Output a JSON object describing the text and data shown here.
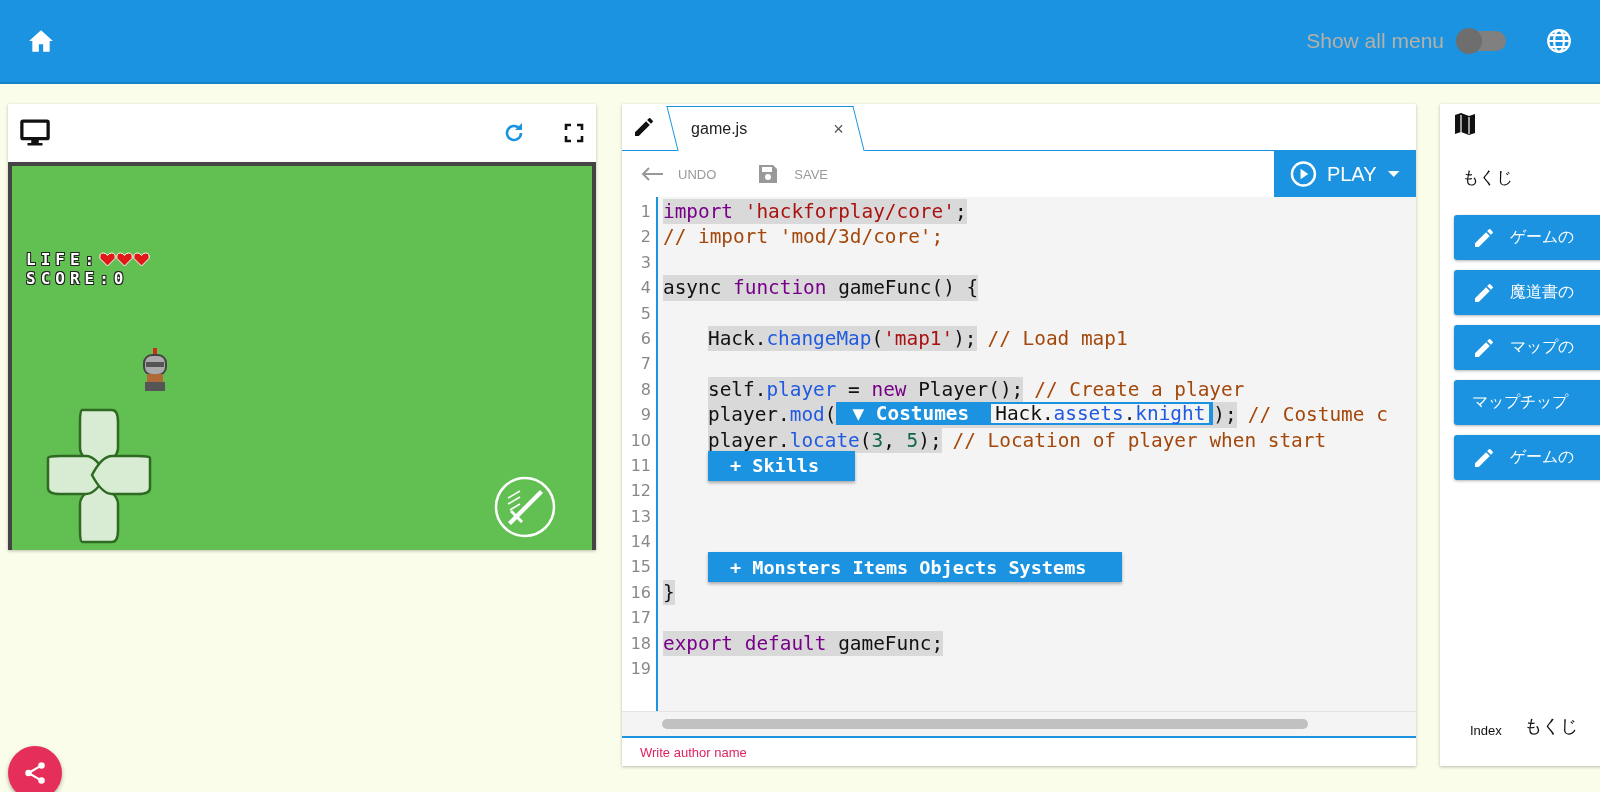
{
  "header": {
    "show_all_menu": {
      "label": "Show all menu",
      "on": false
    }
  },
  "preview": {
    "hud": {
      "life_label": "LIFE:",
      "hearts": [
        {
          "filled": true
        },
        {
          "filled": true
        },
        {
          "filled": true
        }
      ],
      "score": "SCORE:0"
    }
  },
  "editor": {
    "tabs": [
      {
        "label": "game.js",
        "selected": true,
        "close": "×"
      }
    ],
    "toolbar": {
      "undo": {
        "label": "UNDO",
        "disabled": true
      },
      "save": {
        "label": "SAVE",
        "disabled": true
      },
      "play": {
        "label": "PLAY"
      }
    },
    "lines": [
      {
        "number": "1",
        "kind": "code",
        "highlight": true,
        "tokens": [
          {
            "text": "import ",
            "kind": "keyword"
          },
          {
            "text": "'hackforplay/core'",
            "kind": "string"
          },
          {
            "text": ";",
            "kind": "plain"
          }
        ]
      },
      {
        "number": "2",
        "kind": "code",
        "tokens": [
          {
            "text": "// import 'mod/3d/core';",
            "kind": "comment"
          }
        ]
      },
      {
        "number": "3",
        "kind": "code"
      },
      {
        "number": "4",
        "kind": "code",
        "highlight": true,
        "tokens": [
          {
            "text": "async ",
            "kind": "plain"
          },
          {
            "text": "function",
            "kind": "keyword"
          },
          {
            "text": " gameFunc() {",
            "kind": "plain"
          }
        ]
      },
      {
        "number": "5",
        "kind": "code"
      },
      {
        "number": "6",
        "kind": "code",
        "highlight": true,
        "indent": true,
        "tokens": [
          {
            "text": "Hack.",
            "kind": "plain"
          },
          {
            "text": "changeMap",
            "kind": "property"
          },
          {
            "text": "(",
            "kind": "plain"
          },
          {
            "text": "'map1'",
            "kind": "string"
          },
          {
            "text": ");",
            "kind": "plain"
          },
          {
            "text": "// Load map1",
            "kind": "comment"
          }
        ]
      },
      {
        "number": "7",
        "kind": "code"
      },
      {
        "number": "8",
        "kind": "code",
        "highlight": true,
        "indent": true,
        "tokens": [
          {
            "text": "self.",
            "kind": "plain"
          },
          {
            "text": "player",
            "kind": "property"
          },
          {
            "text": " = ",
            "kind": "plain"
          },
          {
            "text": "new",
            "kind": "keyword"
          },
          {
            "text": " Player();",
            "kind": "plain"
          },
          {
            "text": "// Create a player",
            "kind": "comment"
          }
        ]
      },
      {
        "number": "9",
        "kind": "code",
        "highlight": true,
        "indent": true,
        "tokens": [
          {
            "text": "player.",
            "kind": "plain"
          },
          {
            "text": "mod",
            "kind": "property"
          },
          {
            "text": "(",
            "kind": "plain"
          },
          {
            "kind": "widget",
            "label": "▼ Costumes",
            "tokens": [
              {
                "text": "Hack.",
                "kind": "plain"
              },
              {
                "text": "assets",
                "kind": "property"
              },
              {
                "text": ".",
                "kind": "plain"
              },
              {
                "text": "knight",
                "kind": "property"
              }
            ]
          },
          {
            "text": ");",
            "kind": "plain"
          },
          {
            "text": "// Costume c",
            "kind": "comment"
          }
        ]
      },
      {
        "number": "10",
        "kind": "code",
        "highlight": true,
        "indent": true,
        "tokens": [
          {
            "text": "player.",
            "kind": "plain"
          },
          {
            "text": "locate",
            "kind": "property"
          },
          {
            "text": "(",
            "kind": "plain"
          },
          {
            "text": "3",
            "kind": "number"
          },
          {
            "text": ", ",
            "kind": "plain"
          },
          {
            "text": "5",
            "kind": "number"
          },
          {
            "text": ");",
            "kind": "plain"
          },
          {
            "text": "// Location of player when start",
            "kind": "comment"
          }
        ]
      },
      {
        "number": "11",
        "kind": "button",
        "label": "+ Skills"
      },
      {
        "number": "12",
        "kind": "code"
      },
      {
        "number": "13",
        "kind": "code"
      },
      {
        "number": "14",
        "kind": "code"
      },
      {
        "number": "15",
        "kind": "button",
        "label": "+ Monsters Items Objects Systems"
      },
      {
        "number": "16",
        "kind": "code",
        "highlight": true,
        "tokens": [
          {
            "text": "}",
            "kind": "plain"
          }
        ]
      },
      {
        "number": "17",
        "kind": "code"
      },
      {
        "number": "18",
        "kind": "code",
        "highlight": true,
        "tokens": [
          {
            "text": "export default",
            "kind": "keyword"
          },
          {
            "text": " gameFunc;",
            "kind": "plain"
          }
        ]
      },
      {
        "number": "19",
        "kind": "code"
      }
    ],
    "author_placeholder": "Write author name"
  },
  "index_panel": {
    "title": "もくじ",
    "items": [
      {
        "label": "ゲームの",
        "kind": "edit"
      },
      {
        "label": "魔道書の",
        "kind": "edit"
      },
      {
        "label": "マップの",
        "kind": "edit"
      },
      {
        "label": "マップチップ",
        "kind": "plain"
      },
      {
        "label": "ゲームの",
        "kind": "edit"
      }
    ],
    "footer": {
      "label": "Index",
      "value": "もくじ"
    }
  }
}
